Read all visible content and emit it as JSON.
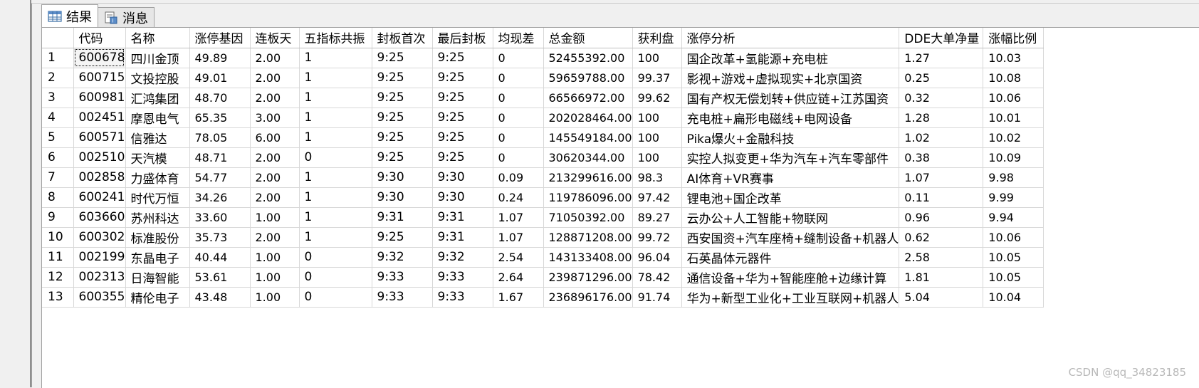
{
  "tabs": [
    {
      "label": "结果",
      "icon": "grid-icon"
    },
    {
      "label": "消息",
      "icon": "message-icon"
    }
  ],
  "columns": [
    "",
    "代码",
    "名称",
    "涨停基因",
    "连板天",
    "五指标共振",
    "封板首次",
    "最后封板",
    "均现差",
    "总金额",
    "获利盘",
    "涨停分析",
    "DDE大单净量",
    "涨幅比例"
  ],
  "rows": [
    [
      "1",
      "600678",
      "四川金顶",
      "49.89",
      "2.00",
      "1",
      "9:25",
      "9:25",
      "0",
      "52455392.00",
      "100",
      "国企改革+氢能源+充电桩",
      "1.27",
      "10.03"
    ],
    [
      "2",
      "600715",
      "文投控股",
      "49.01",
      "2.00",
      "1",
      "9:25",
      "9:25",
      "0",
      "59659788.00",
      "99.37",
      "影视+游戏+虚拟现实+北京国资",
      "0.25",
      "10.08"
    ],
    [
      "3",
      "600981",
      "汇鸿集团",
      "48.70",
      "2.00",
      "1",
      "9:25",
      "9:25",
      "0",
      "66566972.00",
      "99.62",
      "国有产权无偿划转+供应链+江苏国资",
      "0.32",
      "10.06"
    ],
    [
      "4",
      "002451",
      "摩恩电气",
      "65.35",
      "3.00",
      "1",
      "9:25",
      "9:25",
      "0",
      "202028464.00",
      "100",
      "充电桩+扁形电磁线+电网设备",
      "1.28",
      "10.01"
    ],
    [
      "5",
      "600571",
      "信雅达",
      "78.05",
      "6.00",
      "1",
      "9:25",
      "9:25",
      "0",
      "145549184.00",
      "100",
      "Pika爆火+金融科技",
      "1.02",
      "10.02"
    ],
    [
      "6",
      "002510",
      "天汽模",
      "48.71",
      "2.00",
      "0",
      "9:25",
      "9:25",
      "0",
      "30620344.00",
      "100",
      "实控人拟变更+华为汽车+汽车零部件",
      "0.38",
      "10.09"
    ],
    [
      "7",
      "002858",
      "力盛体育",
      "54.77",
      "2.00",
      "1",
      "9:30",
      "9:30",
      "0.09",
      "213299616.00",
      "98.3",
      "AI体育+VR赛事",
      "1.07",
      "9.98"
    ],
    [
      "8",
      "600241",
      "时代万恒",
      "34.26",
      "2.00",
      "1",
      "9:30",
      "9:30",
      "0.24",
      "119786096.00",
      "97.42",
      "锂电池+国企改革",
      "0.11",
      "9.99"
    ],
    [
      "9",
      "603660",
      "苏州科达",
      "33.60",
      "1.00",
      "1",
      "9:31",
      "9:31",
      "1.07",
      "71050392.00",
      "89.27",
      "云办公+人工智能+物联网",
      "0.96",
      "9.94"
    ],
    [
      "10",
      "600302",
      "标准股份",
      "35.73",
      "2.00",
      "1",
      "9:25",
      "9:31",
      "1.07",
      "128871208.00",
      "99.72",
      "西安国资+汽车座椅+缝制设备+机器人",
      "0.62",
      "10.06"
    ],
    [
      "11",
      "002199",
      "东晶电子",
      "40.44",
      "1.00",
      "0",
      "9:32",
      "9:32",
      "2.54",
      "143133408.00",
      "96.04",
      "石英晶体元器件",
      "2.58",
      "10.05"
    ],
    [
      "12",
      "002313",
      "日海智能",
      "53.61",
      "1.00",
      "0",
      "9:33",
      "9:33",
      "2.64",
      "239871296.00",
      "78.42",
      "通信设备+华为+智能座舱+边缘计算",
      "1.81",
      "10.05"
    ],
    [
      "13",
      "600355",
      "精伦电子",
      "43.48",
      "1.00",
      "0",
      "9:33",
      "9:33",
      "1.67",
      "236896176.00",
      "91.74",
      "华为+新型工业化+工业互联网+机器人",
      "5.04",
      "10.04"
    ]
  ],
  "watermark": "CSDN @qq_34823185"
}
